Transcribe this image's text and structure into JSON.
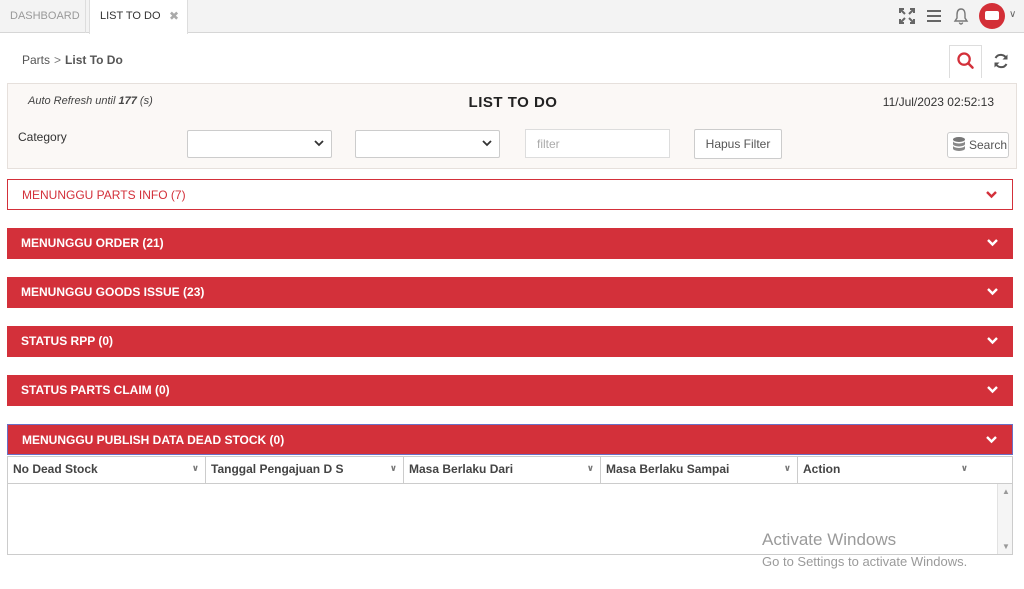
{
  "tabs": [
    {
      "label": "DASHBOARD",
      "active": false
    },
    {
      "label": "LIST TO DO",
      "active": true,
      "close": "✖"
    }
  ],
  "header_icons": [
    "fullscreen-icon",
    "menu-icon",
    "bell-icon",
    "user-avatar",
    "chevron-down-icon"
  ],
  "breadcrumb": {
    "parent": "Parts",
    "separator": ">",
    "current": "List To Do"
  },
  "toolbar_icons": [
    "search-icon",
    "refresh-icon"
  ],
  "panel": {
    "auto_refresh_prefix": "Auto Refresh until",
    "auto_refresh_value": "177",
    "auto_refresh_suffix": "(s)",
    "title": "LIST TO DO",
    "datetime": "11/Jul/2023 02:52:13",
    "category_label": "Category",
    "select1_value": "",
    "select2_value": "",
    "filter_placeholder": "filter",
    "hapus_filter_label": "Hapus Filter",
    "search_label": "Search"
  },
  "sections": [
    {
      "label": "MENUNGGU PARTS INFO (7)"
    },
    {
      "label": "MENUNGGU ORDER (21)"
    },
    {
      "label": "MENUNGGU GOODS ISSUE (23)"
    },
    {
      "label": "STATUS RPP (0)"
    },
    {
      "label": "STATUS PARTS CLAIM (0)"
    },
    {
      "label": "MENUNGGU PUBLISH DATA DEAD STOCK (0)"
    }
  ],
  "grid": {
    "columns": [
      "No Dead Stock",
      "Tanggal Pengajuan D S",
      "Masa Berlaku Dari",
      "Masa Berlaku Sampai",
      "Action"
    ],
    "rows": []
  },
  "watermark": {
    "title": "Activate Windows",
    "subtitle": "Go to Settings to activate Windows."
  },
  "colors": {
    "accent": "#d3303a",
    "panel_bg": "#fbf8f6"
  }
}
